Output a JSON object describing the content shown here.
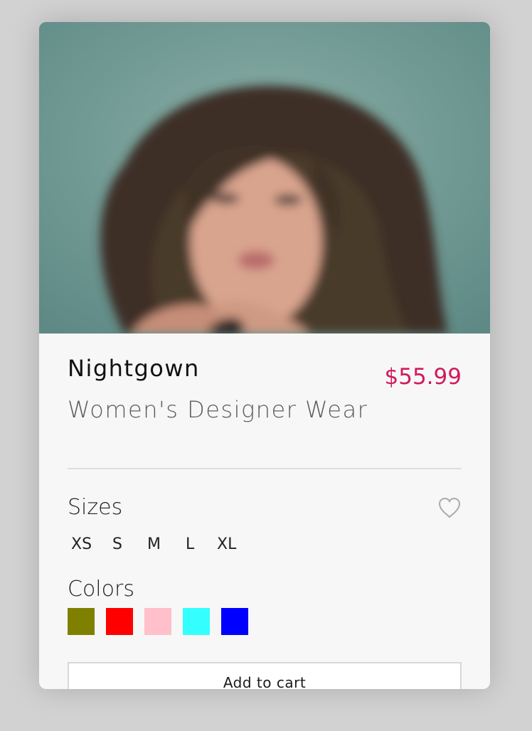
{
  "product": {
    "name": "Nightgown",
    "subtitle": "Women's Designer Wear",
    "price": "$55.99",
    "image_icon": "product-photo"
  },
  "sizes": {
    "label": "Sizes",
    "options": [
      "XS",
      "S",
      "M",
      "L",
      "XL"
    ]
  },
  "colors": {
    "label": "Colors",
    "swatches": [
      "#808000",
      "#ff0000",
      "#ffc0cb",
      "#33ffff",
      "#0000ff"
    ]
  },
  "actions": {
    "wishlist_icon": "heart-icon",
    "add_to_cart_label": "Add to cart"
  },
  "theme": {
    "price_color": "#d21a5c",
    "card_background": "#f7f7f7",
    "page_background": "#d2d2d2"
  }
}
